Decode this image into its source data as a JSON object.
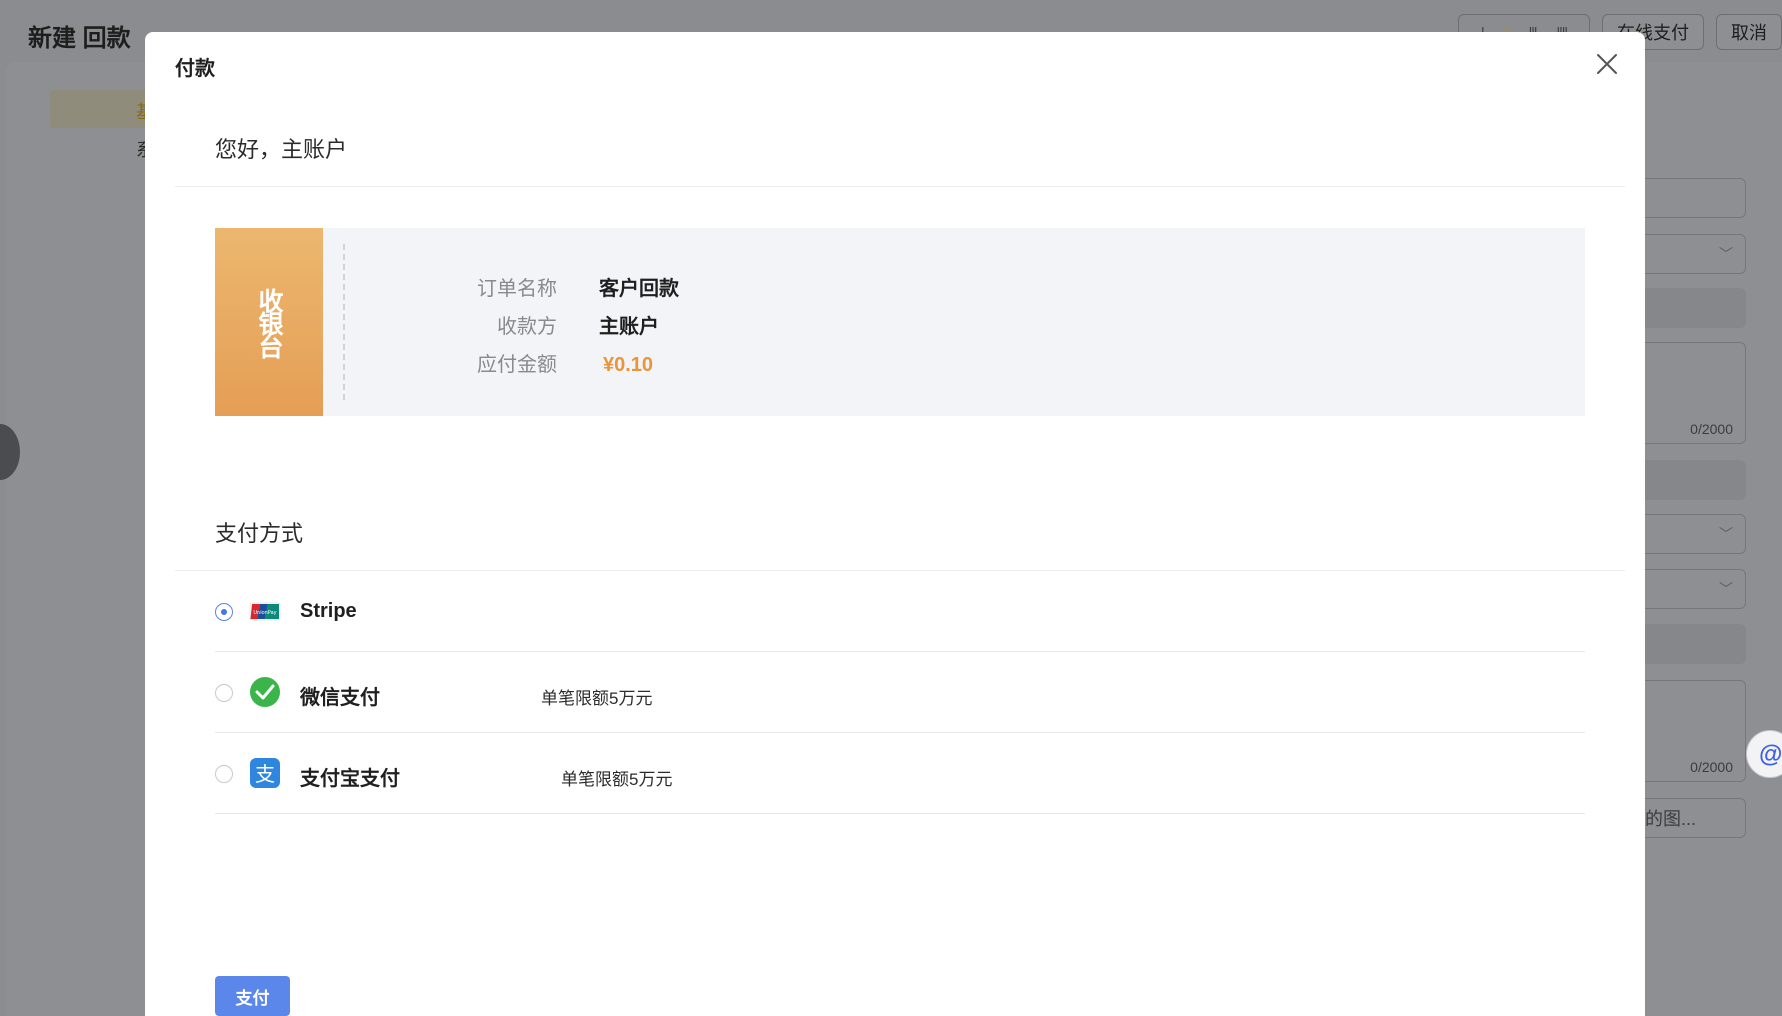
{
  "background": {
    "page_title": "新建 回款",
    "toolbar": {
      "view_bars": [
        "|",
        "||",
        "|||",
        "||||"
      ],
      "online_pay_label": "在线支付",
      "cancel_label": "取消"
    },
    "yellow_text": "基",
    "small_text": "系",
    "counter_1": "0/2000",
    "counter_2": "0/2000",
    "upload_placeholder": "的图..."
  },
  "modal": {
    "title": "付款",
    "greeting": "您好，主账户",
    "cashier_label": "收银台",
    "order": {
      "name_label": "订单名称",
      "name_value": "客户回款",
      "payee_label": "收款方",
      "payee_value": "主账户",
      "amount_label": "应付金额",
      "amount_value": "¥0.10"
    },
    "payment_section_title": "支付方式",
    "payment_methods": [
      {
        "name": "Stripe",
        "note": "",
        "selected": true,
        "icon": "unionpay-icon"
      },
      {
        "name": "微信支付",
        "note": "单笔限额5万元",
        "selected": false,
        "icon": "wechat-pay-icon"
      },
      {
        "name": "支付宝支付",
        "note": "单笔限额5万元",
        "selected": false,
        "icon": "alipay-icon"
      }
    ],
    "pay_button_label": "支付"
  },
  "colors": {
    "accent": "#5b86ea",
    "amount": "#e8953b",
    "cashier": "#e9a95f",
    "wechat": "#3bb54a",
    "alipay": "#2e86de"
  }
}
